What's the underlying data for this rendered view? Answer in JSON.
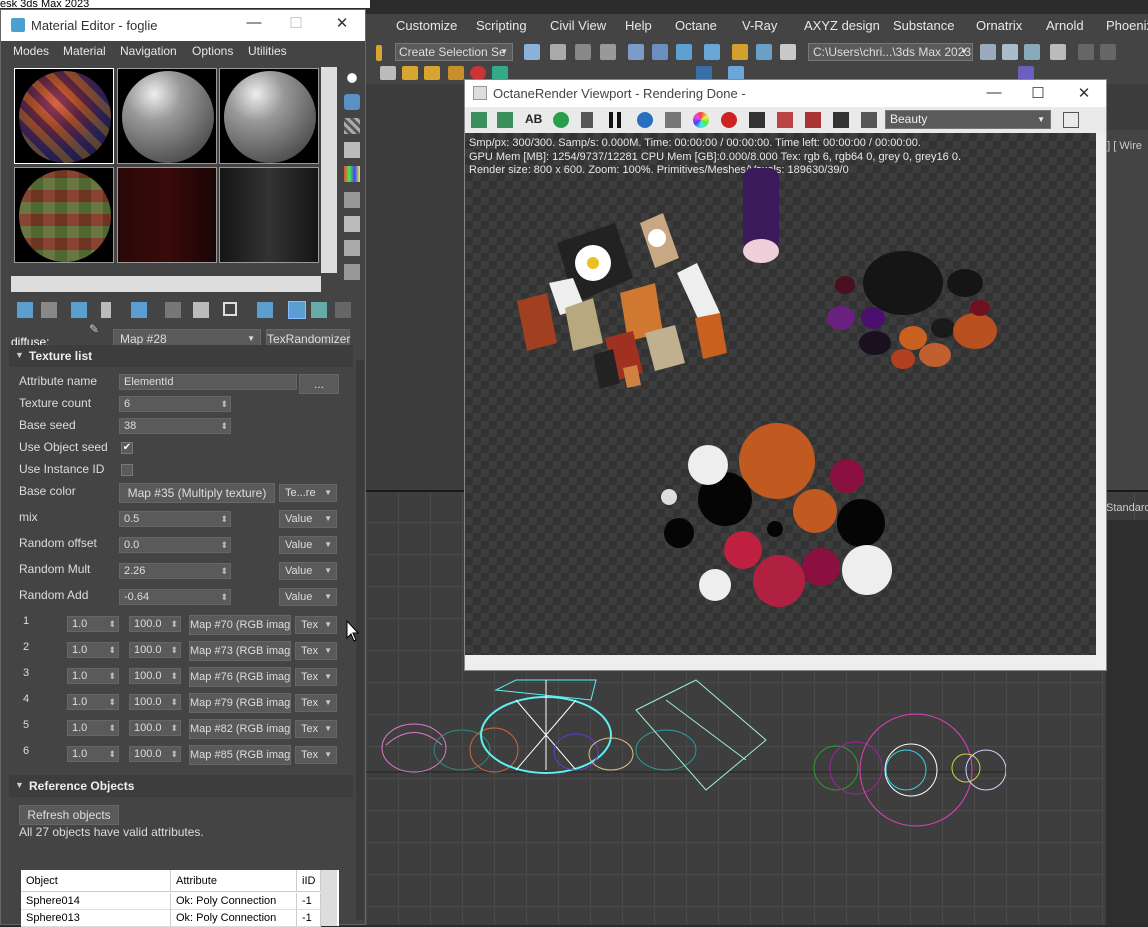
{
  "max": {
    "title": "esk 3ds Max 2023",
    "menu": [
      "Customize",
      "Scripting",
      "Civil View",
      "Help",
      "Octane",
      "V-Ray",
      "AXYZ design",
      "Substance",
      "Ornatrix",
      "Arnold",
      "Phoenix"
    ],
    "selection_set": "Create Selection Se",
    "project_path": "C:\\Users\\chri...\\3ds Max 2023",
    "viewport_label_right": "d ] [ Wire",
    "viewport_label_std": "Standard"
  },
  "material_editor": {
    "title": "Material Editor - foglie",
    "menu": [
      "Modes",
      "Material",
      "Navigation",
      "Options",
      "Utilities"
    ],
    "diffuse_label": "diffuse:",
    "diffuse_map": "Map #28",
    "diffuse_type": "TexRandomizer",
    "texture_list": {
      "header": "Texture list",
      "attribute_name_label": "Attribute name",
      "attribute_name_value": "ElementId",
      "attribute_browse": "...",
      "texture_count_label": "Texture count",
      "texture_count_value": "6",
      "base_seed_label": "Base seed",
      "base_seed_value": "38",
      "use_object_seed_label": "Use Object seed",
      "use_object_seed_checked": "✔",
      "use_instance_id_label": "Use Instance ID",
      "base_color_label": "Base color",
      "base_color_map": "Map #35 (Multiply texture)",
      "base_color_type": "Te...re",
      "params": [
        {
          "label": "mix",
          "value": "0.5",
          "type": "Value"
        },
        {
          "label": "Random offset",
          "value": "0.0",
          "type": "Value"
        },
        {
          "label": "Random Mult",
          "value": "2.26",
          "type": "Value"
        },
        {
          "label": "Random Add",
          "value": "-0.64",
          "type": "Value"
        }
      ],
      "rows": [
        {
          "idx": "1",
          "a": "1.0",
          "b": "100.0",
          "map": "Map #70 (RGB image",
          "type": "Tex"
        },
        {
          "idx": "2",
          "a": "1.0",
          "b": "100.0",
          "map": "Map #73 (RGB image",
          "type": "Tex"
        },
        {
          "idx": "3",
          "a": "1.0",
          "b": "100.0",
          "map": "Map #76 (RGB image",
          "type": "Tex"
        },
        {
          "idx": "4",
          "a": "1.0",
          "b": "100.0",
          "map": "Map #79 (RGB image",
          "type": "Tex"
        },
        {
          "idx": "5",
          "a": "1.0",
          "b": "100.0",
          "map": "Map #82 (RGB image",
          "type": "Tex"
        },
        {
          "idx": "6",
          "a": "1.0",
          "b": "100.0",
          "map": "Map #85 (RGB image",
          "type": "Tex"
        }
      ]
    },
    "reference_objects": {
      "header": "Reference Objects",
      "refresh_button": "Refresh objects",
      "status": "All 27 objects have valid attributes.",
      "columns": [
        "Object",
        "Attribute",
        "iID"
      ],
      "rows": [
        {
          "object": "Sphere014",
          "attribute": "Ok: Poly Connection",
          "iid": "-1"
        },
        {
          "object": "Sphere013",
          "attribute": "Ok: Poly Connection",
          "iid": "-1"
        }
      ]
    }
  },
  "octane": {
    "title": "OctaneRender Viewport - Rendering Done -",
    "pass": "Beauty",
    "toolbar_ab": "AB",
    "stats": [
      "Smp/px: 300/300.   Samp/s: 0.000M.   Time: 00:00:00 / 00:00:00.   Time left: 00:00:00 / 00:00:00.",
      "GPU Mem [MB]: 1254/9737/12281   CPU Mem [GB]:0.000/8.000   Tex: rgb 6, rgb64 0, grey 0, grey16 0.",
      "Render size: 800 x 600.   Zoom: 100%.   Primitives/Meshes/Voxels: 189630/39/0"
    ]
  }
}
